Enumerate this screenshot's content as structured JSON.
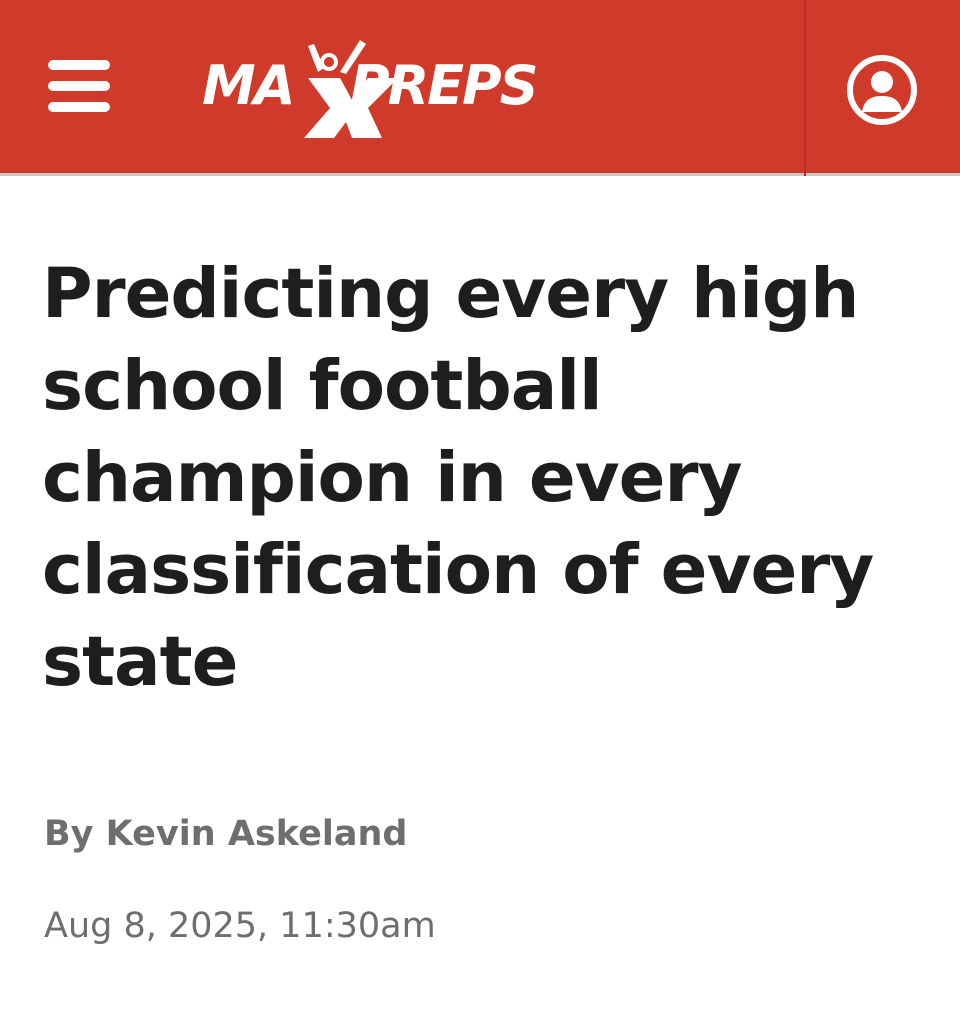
{
  "header": {
    "background_color": "#d03a2b",
    "menu_icon": "hamburger-menu-icon",
    "logo_text": "MAXPREPS",
    "account_icon": "user-account-icon"
  },
  "article": {
    "headline": "Predicting every high school football champion in every classification of every state",
    "byline": "By Kevin Askeland",
    "date": "Aug 8, 2025, 11:30am",
    "text_color": "#1e1e1e",
    "meta_color": "#6e6e6e"
  }
}
